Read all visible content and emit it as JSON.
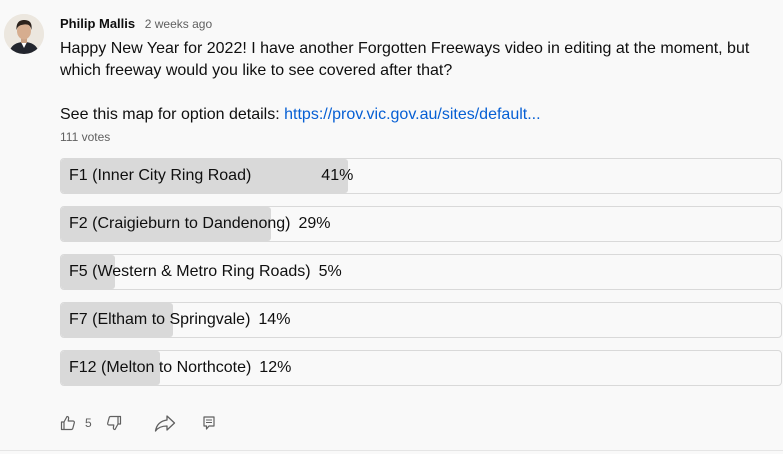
{
  "comment": {
    "author": "Philip Mallis",
    "timestamp": "2 weeks ago",
    "text_line1": "Happy New Year for 2022! I have another Forgotten Freeways video in editing at the moment, but which freeway would you like to see covered after that?",
    "text_prefix": "See this map for option details: ",
    "link_text": "https://prov.vic.gov.au/sites/default...",
    "avatar_icon": "person-avatar"
  },
  "poll": {
    "votes": "111 votes",
    "options": [
      {
        "label": "F1 (Inner City Ring Road)",
        "percent_text": "41%",
        "percent": 41
      },
      {
        "label": "F2 (Craigieburn to Dandenong)",
        "percent_text": "29%",
        "percent": 29
      },
      {
        "label": "F5 (Western & Metro Ring Roads)",
        "percent_text": "5%",
        "percent": 5
      },
      {
        "label": "F7 (Eltham to Springvale)",
        "percent_text": "14%",
        "percent": 14
      },
      {
        "label": "F12 (Melton to Northcote)",
        "percent_text": "12%",
        "percent": 12
      }
    ]
  },
  "actions": {
    "like_count": "5",
    "icons": [
      "thumb-up-icon",
      "thumb-down-icon",
      "share-icon",
      "reply-icon"
    ]
  },
  "colors": {
    "link": "#065fd4",
    "bar_fill": "#d9d9d9",
    "background": "#f9f9f9"
  }
}
